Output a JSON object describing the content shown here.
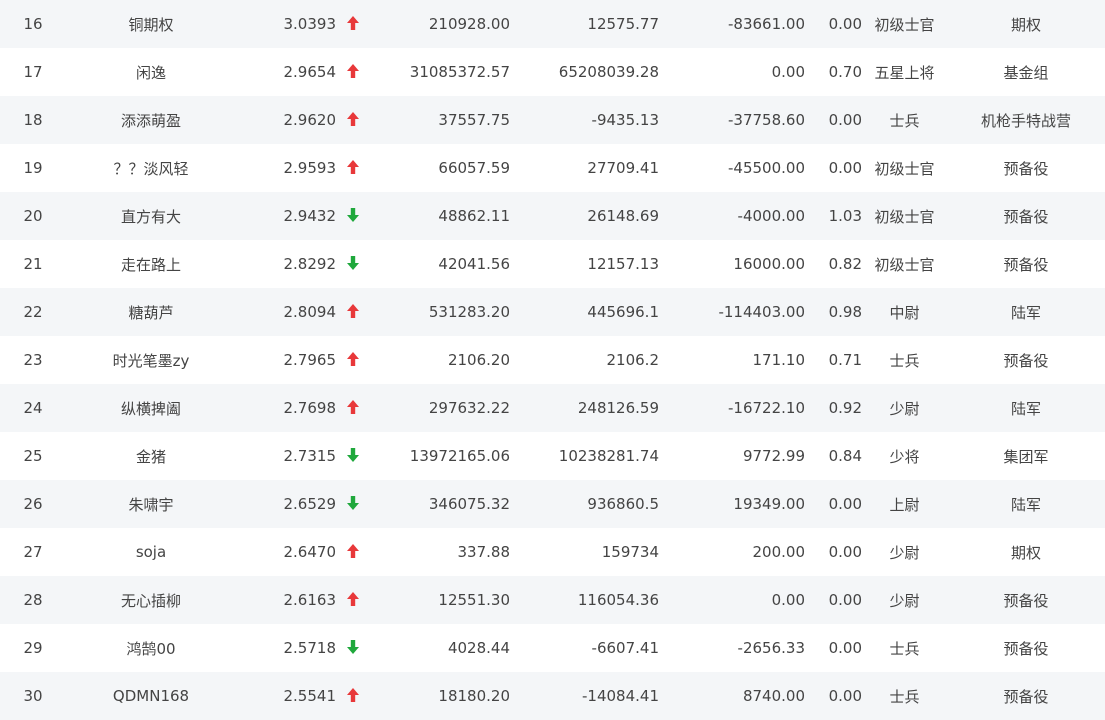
{
  "colors": {
    "up": "#e8383a",
    "down": "#1fa83c",
    "stripe": "#f4f6f8",
    "text": "#444444"
  },
  "rows": [
    {
      "rank": "16",
      "name": "铜期权",
      "score": "3.0393",
      "trend": "up",
      "total": "210928.00",
      "month": "12575.77",
      "day": "-83661.00",
      "position": "0.00",
      "level": "初级士官",
      "group": "期权"
    },
    {
      "rank": "17",
      "name": "闲逸",
      "score": "2.9654",
      "trend": "up",
      "total": "31085372.57",
      "month": "65208039.28",
      "day": "0.00",
      "position": "0.70",
      "level": "五星上将",
      "group": "基金组"
    },
    {
      "rank": "18",
      "name": "添添萌盈",
      "score": "2.9620",
      "trend": "up",
      "total": "37557.75",
      "month": "-9435.13",
      "day": "-37758.60",
      "position": "0.00",
      "level": "士兵",
      "group": "机枪手特战营"
    },
    {
      "rank": "19",
      "name": "？？淡风轻",
      "score": "2.9593",
      "trend": "up",
      "total": "66057.59",
      "month": "27709.41",
      "day": "-45500.00",
      "position": "0.00",
      "level": "初级士官",
      "group": "预备役"
    },
    {
      "rank": "20",
      "name": "直方有大",
      "score": "2.9432",
      "trend": "down",
      "total": "48862.11",
      "month": "26148.69",
      "day": "-4000.00",
      "position": "1.03",
      "level": "初级士官",
      "group": "预备役"
    },
    {
      "rank": "21",
      "name": "走在路上",
      "score": "2.8292",
      "trend": "down",
      "total": "42041.56",
      "month": "12157.13",
      "day": "16000.00",
      "position": "0.82",
      "level": "初级士官",
      "group": "预备役"
    },
    {
      "rank": "22",
      "name": "糖葫芦",
      "score": "2.8094",
      "trend": "up",
      "total": "531283.20",
      "month": "445696.1",
      "day": "-114403.00",
      "position": "0.98",
      "level": "中尉",
      "group": "陆军"
    },
    {
      "rank": "23",
      "name": "时光笔墨zy",
      "score": "2.7965",
      "trend": "up",
      "total": "2106.20",
      "month": "2106.2",
      "day": "171.10",
      "position": "0.71",
      "level": "士兵",
      "group": "预备役"
    },
    {
      "rank": "24",
      "name": "纵横捭阖",
      "score": "2.7698",
      "trend": "up",
      "total": "297632.22",
      "month": "248126.59",
      "day": "-16722.10",
      "position": "0.92",
      "level": "少尉",
      "group": "陆军"
    },
    {
      "rank": "25",
      "name": "金猪",
      "score": "2.7315",
      "trend": "down",
      "total": "13972165.06",
      "month": "10238281.74",
      "day": "9772.99",
      "position": "0.84",
      "level": "少将",
      "group": "集团军"
    },
    {
      "rank": "26",
      "name": "朱啸宇",
      "score": "2.6529",
      "trend": "down",
      "total": "346075.32",
      "month": "936860.5",
      "day": "19349.00",
      "position": "0.00",
      "level": "上尉",
      "group": "陆军"
    },
    {
      "rank": "27",
      "name": "soja",
      "score": "2.6470",
      "trend": "up",
      "total": "337.88",
      "month": "159734",
      "day": "200.00",
      "position": "0.00",
      "level": "少尉",
      "group": "期权"
    },
    {
      "rank": "28",
      "name": "无心插柳",
      "score": "2.6163",
      "trend": "up",
      "total": "12551.30",
      "month": "116054.36",
      "day": "0.00",
      "position": "0.00",
      "level": "少尉",
      "group": "预备役"
    },
    {
      "rank": "29",
      "name": "鸿鹄00",
      "score": "2.5718",
      "trend": "down",
      "total": "4028.44",
      "month": "-6607.41",
      "day": "-2656.33",
      "position": "0.00",
      "level": "士兵",
      "group": "预备役"
    },
    {
      "rank": "30",
      "name": "QDMN168",
      "score": "2.5541",
      "trend": "up",
      "total": "18180.20",
      "month": "-14084.41",
      "day": "8740.00",
      "position": "0.00",
      "level": "士兵",
      "group": "预备役"
    }
  ]
}
